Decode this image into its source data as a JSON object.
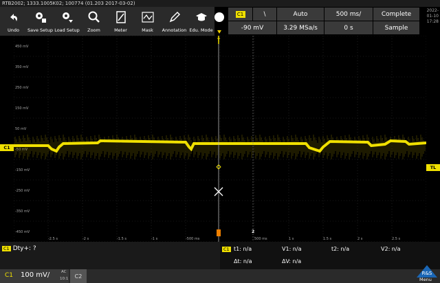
{
  "title": "RTB2002; 1333.1005K02; 100774 (01.203 2017-03-02)",
  "toolbar": [
    {
      "label": "Undo",
      "icon": "undo-icon"
    },
    {
      "label": "Save Setup",
      "icon": "save-setup-icon"
    },
    {
      "label": "Load Setup",
      "icon": "load-setup-icon"
    },
    {
      "label": "Zoom",
      "icon": "zoom-icon"
    },
    {
      "label": "Meter",
      "icon": "meter-icon"
    },
    {
      "label": "Mask",
      "icon": "mask-icon"
    },
    {
      "label": "Annotation",
      "icon": "annotation-icon"
    },
    {
      "label": "Edu. Mode",
      "icon": "edu-mode-icon"
    }
  ],
  "trigger": {
    "source": "C1",
    "slope": "\\",
    "mode": "Auto",
    "level": "-90 mV"
  },
  "acquisition": {
    "timebase": "500 ms/",
    "rate": "3.29 MSa/s",
    "position": "0 s",
    "state": "Complete",
    "mode": "Sample"
  },
  "datetime": {
    "date": "2022-01-10",
    "time": "17:28"
  },
  "yticks": [
    "450 mV",
    "350 mV",
    "250 mV",
    "150 mV",
    "50 mV",
    "-50 mV",
    "-150 mV",
    "-250 mV",
    "-350 mV",
    "-450 mV"
  ],
  "xticks": [
    "-2.5 s",
    "-2 s",
    "-1.5 s",
    "-1 s",
    "-500 ms",
    "500 ms",
    "1 s",
    "1.5 s",
    "2 s",
    "2.5 s"
  ],
  "markers": {
    "ch1": "C1",
    "tl": "TL",
    "trig": "T",
    "ref2": "2"
  },
  "measure": {
    "ch": "C1",
    "text": "Dty+: ?"
  },
  "cursors": {
    "ch": "C1",
    "t1": "t1: n/a",
    "t2": "t2: n/a",
    "dt": "Δt: n/a",
    "v1": "V1: n/a",
    "v2": "V2: n/a",
    "dv": "ΔV: n/a"
  },
  "channel": {
    "ch1_label": "C1",
    "ch1_scale": "100 mV/",
    "coupling": "AC",
    "probe": "10:1",
    "ch2_label": "C2"
  },
  "menu_label": "Menu",
  "colors": {
    "trace": "#f0e000",
    "grid": "#3a3a3a",
    "toolbar": "#2a2a2a"
  }
}
